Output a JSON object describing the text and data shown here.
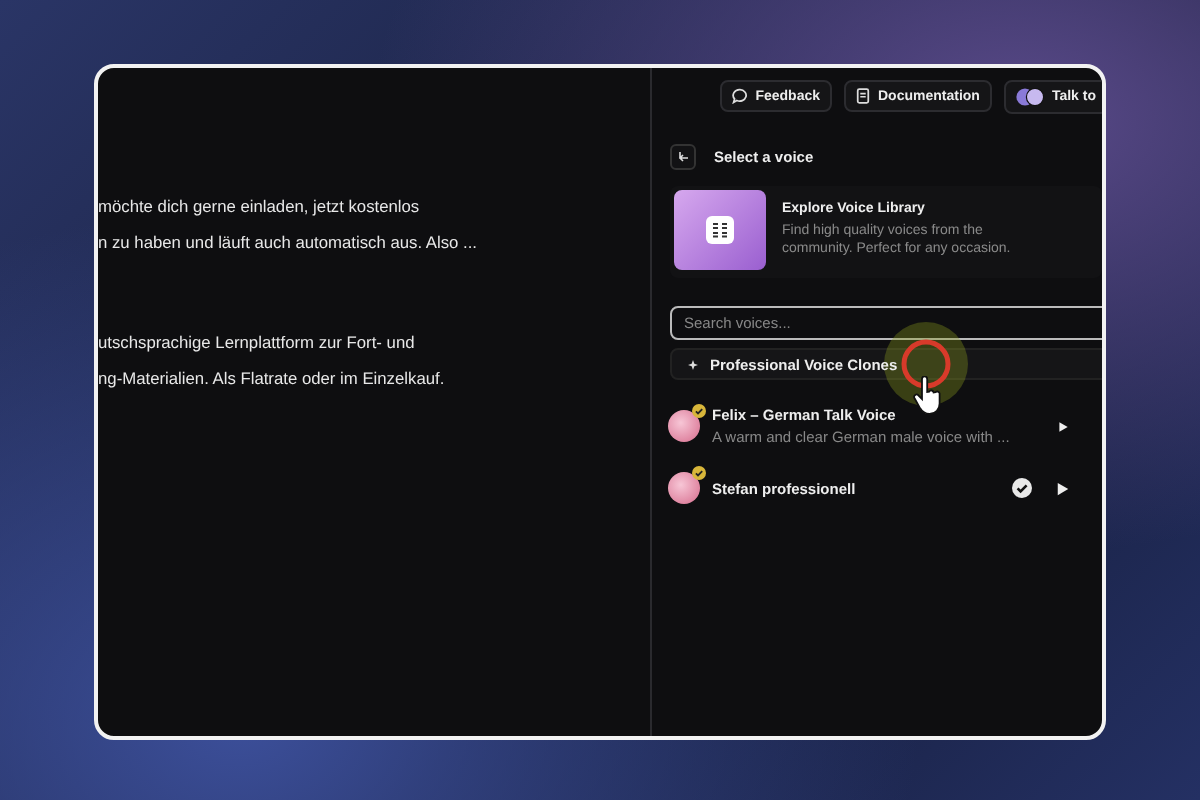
{
  "top_bar": {
    "buttons": [
      {
        "label": "Feedback",
        "kind": "feedback"
      },
      {
        "label": "Documentation",
        "kind": "docs"
      },
      {
        "label": "Talk to",
        "kind": "talk"
      }
    ]
  },
  "editor": {
    "paragraphs": [
      {
        "lines": [
          "möchte dich gerne einladen, jetzt kostenlos",
          "n zu haben und läuft auch automatisch aus. Also ..."
        ]
      },
      {
        "lines": [
          "utschsprachige Lernplattform zur Fort- und",
          "ng-Materialien. Als Flatrate oder im Einzelkauf."
        ]
      }
    ]
  },
  "voice_panel": {
    "title": "Select a voice",
    "library_card": {
      "title": "Explore Voice Library",
      "description": "Find high quality voices from the community. Perfect for any occasion."
    },
    "search": {
      "placeholder": "Search voices..."
    },
    "category": {
      "label": "Professional Voice Clones"
    },
    "voices": [
      {
        "name": "Felix – German Talk Voice",
        "description": "A warm and clear German male voice with ...",
        "selected": false
      },
      {
        "name": "Stefan professionell",
        "selected": true
      }
    ]
  }
}
